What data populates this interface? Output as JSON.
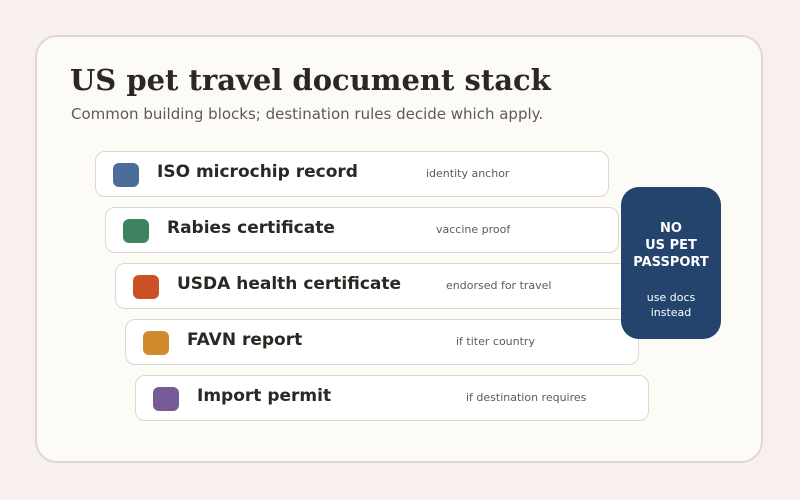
{
  "header": {
    "title": "US pet travel document stack",
    "subtitle": "Common building blocks; destination rules decide which apply."
  },
  "stack": [
    {
      "label": "ISO microchip record",
      "note": "identity anchor",
      "color": "#4a6d99",
      "icon": "microchip-swatch"
    },
    {
      "label": "Rabies certificate",
      "note": "vaccine proof",
      "color": "#3e8262",
      "icon": "rabies-swatch"
    },
    {
      "label": "USDA health certificate",
      "note": "endorsed for travel",
      "color": "#cb5124",
      "icon": "usda-swatch"
    },
    {
      "label": "FAVN report",
      "note": "if titer country",
      "color": "#d08a2b",
      "icon": "favn-swatch"
    },
    {
      "label": "Import permit",
      "note": "if destination requires",
      "color": "#775b96",
      "icon": "permit-swatch"
    }
  ],
  "callout": {
    "heading_lines": [
      "NO",
      "US PET",
      "PASSPORT"
    ],
    "note_lines": [
      "use docs",
      "instead"
    ],
    "color": "#24446e"
  }
}
